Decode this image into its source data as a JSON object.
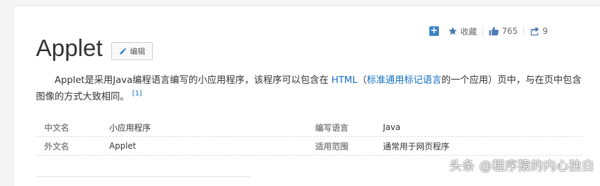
{
  "actions": {
    "collect_label": "收藏",
    "like_count": "765",
    "share_count": "9"
  },
  "title": "Applet",
  "edit_label": "编辑",
  "summary": {
    "part1": "Applet是采用Java编程语言编写的小应用程序，该程序可以包含在 ",
    "link1": "HTML",
    "part2": "（",
    "link2": "标准通用标记语言",
    "part3": "的一个应用）页中，与在页中包含图像的方式大致相同。 ",
    "ref": "[1]"
  },
  "info": [
    {
      "k1": "中文名",
      "v1": "小应用程序",
      "k2": "编写语言",
      "v2": "Java"
    },
    {
      "k1": "外文名",
      "v1": "Applet",
      "k2": "适用范围",
      "v2": "通常用于网页程序"
    }
  ],
  "watermark": "头条 @程序猿的内心独白",
  "colors": {
    "link": "#136ec2",
    "plus_button": "#3b83c6"
  }
}
